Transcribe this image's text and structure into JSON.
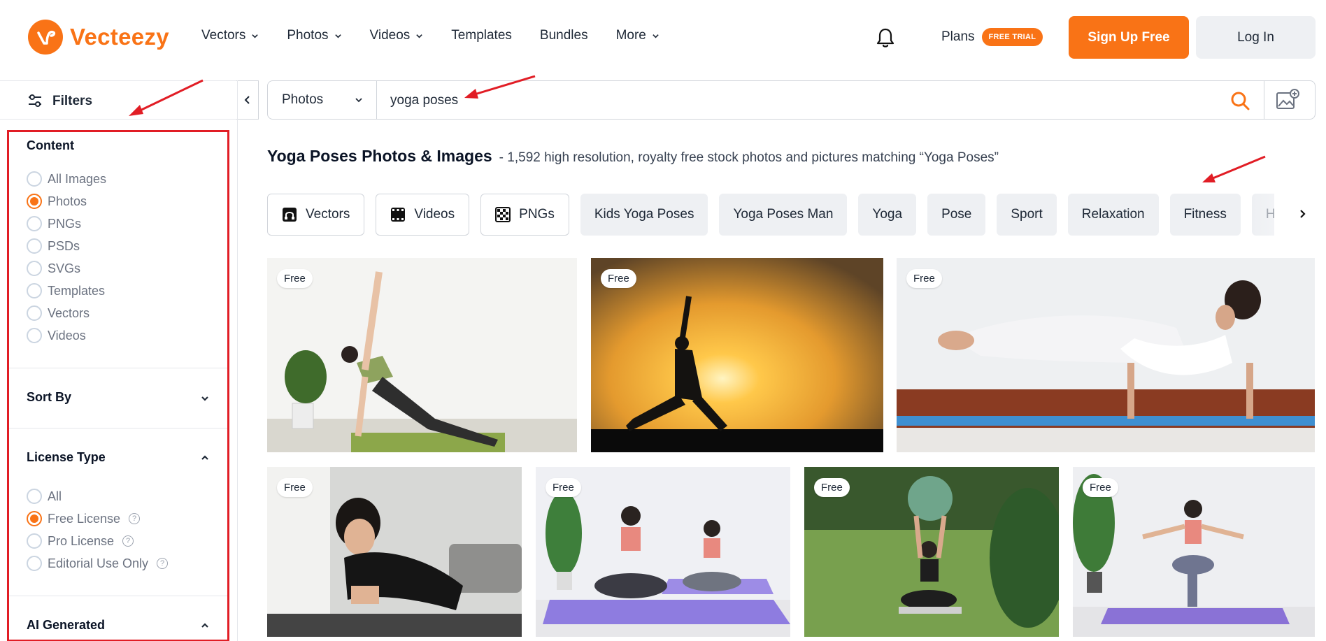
{
  "brand": {
    "name": "Vecteezy",
    "color": "#f97316"
  },
  "nav": {
    "items": [
      {
        "label": "Vectors",
        "has_menu": true
      },
      {
        "label": "Photos",
        "has_menu": true
      },
      {
        "label": "Videos",
        "has_menu": true
      },
      {
        "label": "Templates",
        "has_menu": false
      },
      {
        "label": "Bundles",
        "has_menu": false
      },
      {
        "label": "More",
        "has_menu": true
      }
    ],
    "plans_label": "Plans",
    "trial_badge": "FREE TRIAL",
    "signup_label": "Sign Up Free",
    "login_label": "Log In"
  },
  "sidebar": {
    "filters_label": "Filters",
    "content": {
      "title": "Content",
      "options": [
        {
          "label": "All Images",
          "selected": false
        },
        {
          "label": "Photos",
          "selected": true
        },
        {
          "label": "PNGs",
          "selected": false
        },
        {
          "label": "PSDs",
          "selected": false
        },
        {
          "label": "SVGs",
          "selected": false
        },
        {
          "label": "Templates",
          "selected": false
        },
        {
          "label": "Vectors",
          "selected": false
        },
        {
          "label": "Videos",
          "selected": false
        }
      ]
    },
    "sort_by": {
      "title": "Sort By",
      "expanded": false
    },
    "license": {
      "title": "License Type",
      "expanded": true,
      "options": [
        {
          "label": "All",
          "selected": false,
          "help": false
        },
        {
          "label": "Free License",
          "selected": true,
          "help": true
        },
        {
          "label": "Pro License",
          "selected": false,
          "help": true
        },
        {
          "label": "Editorial Use Only",
          "selected": false,
          "help": true
        }
      ]
    },
    "ai_generated": {
      "title": "AI Generated",
      "expanded": true
    }
  },
  "search": {
    "category": "Photos",
    "query": "yoga poses"
  },
  "results": {
    "title": "Yoga Poses Photos & Images",
    "subtitle": "- 1,592 high resolution, royalty free stock photos and pictures matching “Yoga Poses”"
  },
  "chips": [
    {
      "label": "Vectors",
      "icon": "vector-icon",
      "style": "outline"
    },
    {
      "label": "Videos",
      "icon": "video-icon",
      "style": "outline"
    },
    {
      "label": "PNGs",
      "icon": "png-checker-icon",
      "style": "outline"
    },
    {
      "label": "Kids Yoga Poses",
      "style": "fill"
    },
    {
      "label": "Yoga Poses Man",
      "style": "fill"
    },
    {
      "label": "Yoga",
      "style": "fill"
    },
    {
      "label": "Pose",
      "style": "fill"
    },
    {
      "label": "Sport",
      "style": "fill"
    },
    {
      "label": "Relaxation",
      "style": "fill"
    },
    {
      "label": "Fitness",
      "style": "fill"
    },
    {
      "label": "Health",
      "style": "fade"
    }
  ],
  "images": [
    {
      "badge": "Free",
      "subject": "woman side plank on green mat"
    },
    {
      "badge": "Free",
      "subject": "silhouette yoga at sunset"
    },
    {
      "badge": "Free",
      "subject": "woman arm balance on blue mat"
    },
    {
      "badge": "Free",
      "subject": "woman plank at home"
    },
    {
      "badge": "Free",
      "subject": "two women meditating on purple mats"
    },
    {
      "badge": "Free",
      "subject": "woman with ball outdoors"
    },
    {
      "badge": "Free",
      "subject": "woman balance pose on purple mat"
    }
  ],
  "annotation_color": "#e11d25"
}
